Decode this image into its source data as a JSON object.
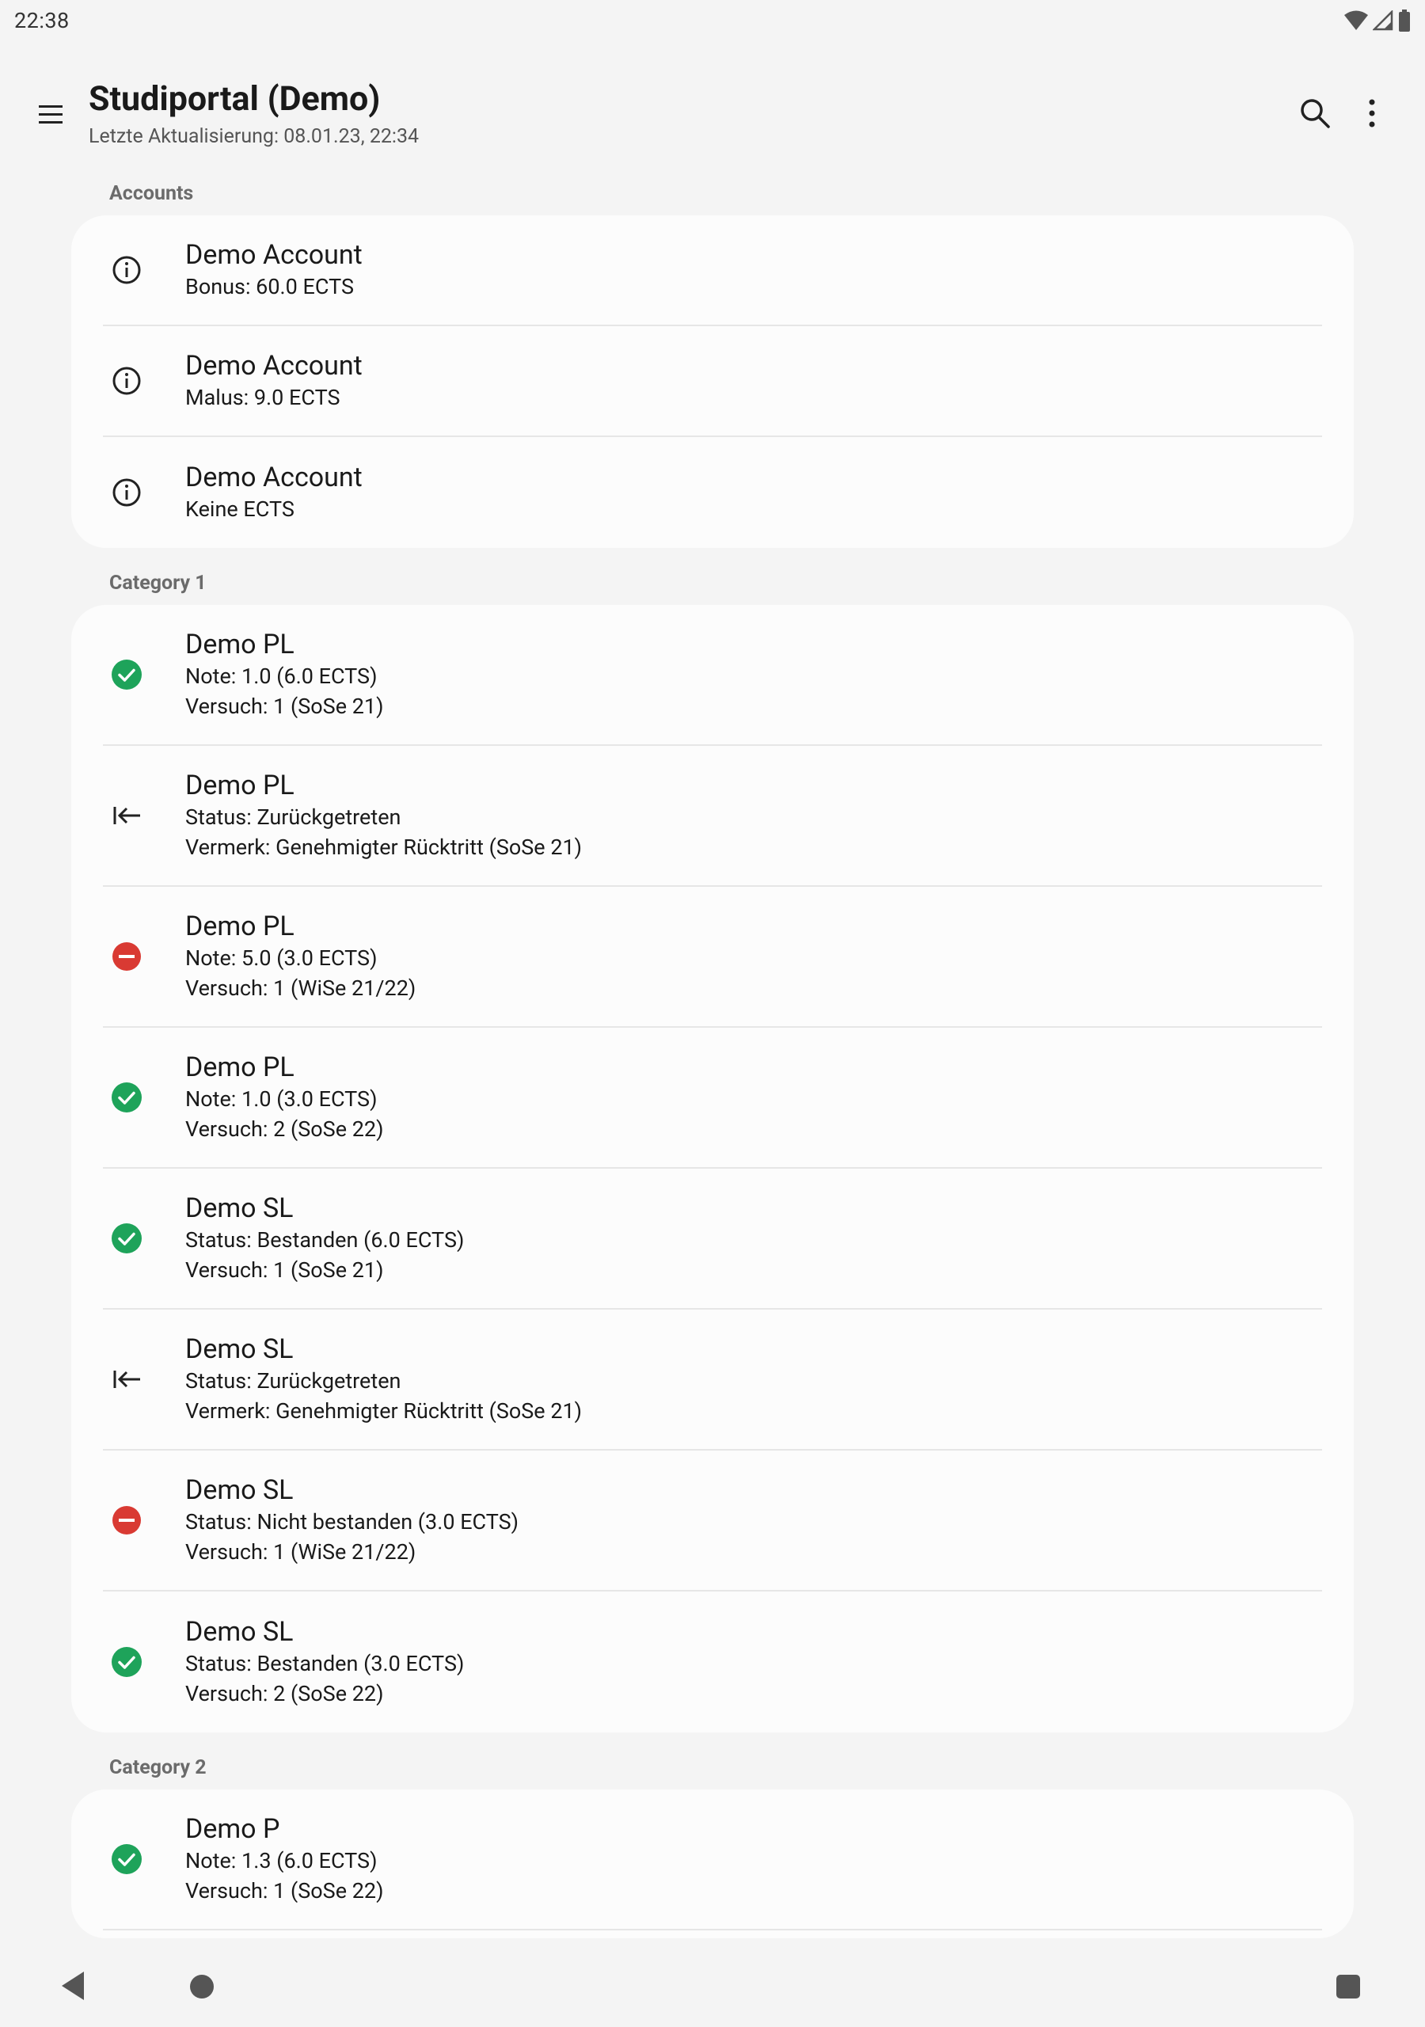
{
  "status_bar": {
    "time": "22:38"
  },
  "app_bar": {
    "title": "Studiportal (Demo)",
    "subtitle": "Letzte Aktualisierung: 08.01.23, 22:34"
  },
  "sections": [
    {
      "header": "Accounts",
      "items": [
        {
          "icon": "info-icon",
          "title": "Demo Account",
          "lines": [
            "Bonus: 60.0 ECTS"
          ]
        },
        {
          "icon": "info-icon",
          "title": "Demo Account",
          "lines": [
            "Malus: 9.0 ECTS"
          ]
        },
        {
          "icon": "info-icon",
          "title": "Demo Account",
          "lines": [
            "Keine ECTS"
          ]
        }
      ]
    },
    {
      "header": "Category 1",
      "items": [
        {
          "icon": "check-circle-icon",
          "title": "Demo PL",
          "lines": [
            "Note: 1.0 (6.0 ECTS)",
            "Versuch: 1 (SoSe 21)"
          ]
        },
        {
          "icon": "withdraw-icon",
          "title": "Demo PL",
          "lines": [
            "Status: Zurückgetreten",
            "Vermerk: Genehmigter Rücktritt (SoSe 21)"
          ]
        },
        {
          "icon": "minus-circle-icon",
          "title": "Demo PL",
          "lines": [
            "Note: 5.0 (3.0 ECTS)",
            "Versuch: 1 (WiSe 21/22)"
          ]
        },
        {
          "icon": "check-circle-icon",
          "title": "Demo PL",
          "lines": [
            "Note: 1.0 (3.0 ECTS)",
            "Versuch: 2 (SoSe 22)"
          ]
        },
        {
          "icon": "check-circle-icon",
          "title": "Demo SL",
          "lines": [
            "Status: Bestanden (6.0 ECTS)",
            "Versuch: 1 (SoSe 21)"
          ]
        },
        {
          "icon": "withdraw-icon",
          "title": "Demo SL",
          "lines": [
            "Status: Zurückgetreten",
            "Vermerk: Genehmigter Rücktritt (SoSe 21)"
          ]
        },
        {
          "icon": "minus-circle-icon",
          "title": "Demo SL",
          "lines": [
            "Status: Nicht bestanden (3.0 ECTS)",
            "Versuch: 1 (WiSe 21/22)"
          ]
        },
        {
          "icon": "check-circle-icon",
          "title": "Demo SL",
          "lines": [
            "Status: Bestanden (3.0 ECTS)",
            "Versuch: 2 (SoSe 22)"
          ]
        }
      ]
    },
    {
      "header": "Category 2",
      "items": [
        {
          "icon": "check-circle-icon",
          "title": "Demo P",
          "lines": [
            "Note: 1.3 (6.0 ECTS)",
            "Versuch: 1 (SoSe 22)"
          ]
        }
      ]
    }
  ],
  "colors": {
    "success": "#1ea35a",
    "failure": "#d93a33",
    "background": "#f4f4f4",
    "card": "#fcfcfc"
  }
}
